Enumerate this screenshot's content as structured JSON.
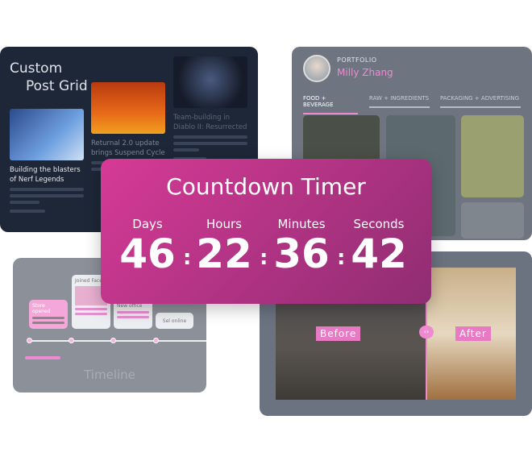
{
  "post_grid": {
    "title_line1": "Custom",
    "title_line2": "Post Grid",
    "posts": [
      {
        "caption": "Building the blasters of Nerf Legends"
      },
      {
        "caption": "Returnal 2.0 update brings Suspend Cycle"
      },
      {
        "caption": "Team-building in Diablo II: Resurrected"
      }
    ]
  },
  "portfolio": {
    "label": "PORTFOLIO",
    "name": "Milly Zhang",
    "tabs": [
      "FOOD + BEVERAGE",
      "RAW + INGREDIENTS",
      "PACKAGING + ADVERTISING"
    ],
    "active_tab": 0,
    "accent": "#f08ad0"
  },
  "countdown": {
    "title": "Countdown Timer",
    "units": [
      {
        "label": "Days",
        "value": "46"
      },
      {
        "label": "Hours",
        "value": "22"
      },
      {
        "label": "Minutes",
        "value": "36"
      },
      {
        "label": "Seconds",
        "value": "42"
      }
    ],
    "separator": ":"
  },
  "timeline": {
    "title": "Timeline",
    "events": [
      "Store opened",
      "Joined Face",
      "New office",
      "Sel online"
    ]
  },
  "before_after": {
    "before": "Before",
    "after": "After"
  }
}
